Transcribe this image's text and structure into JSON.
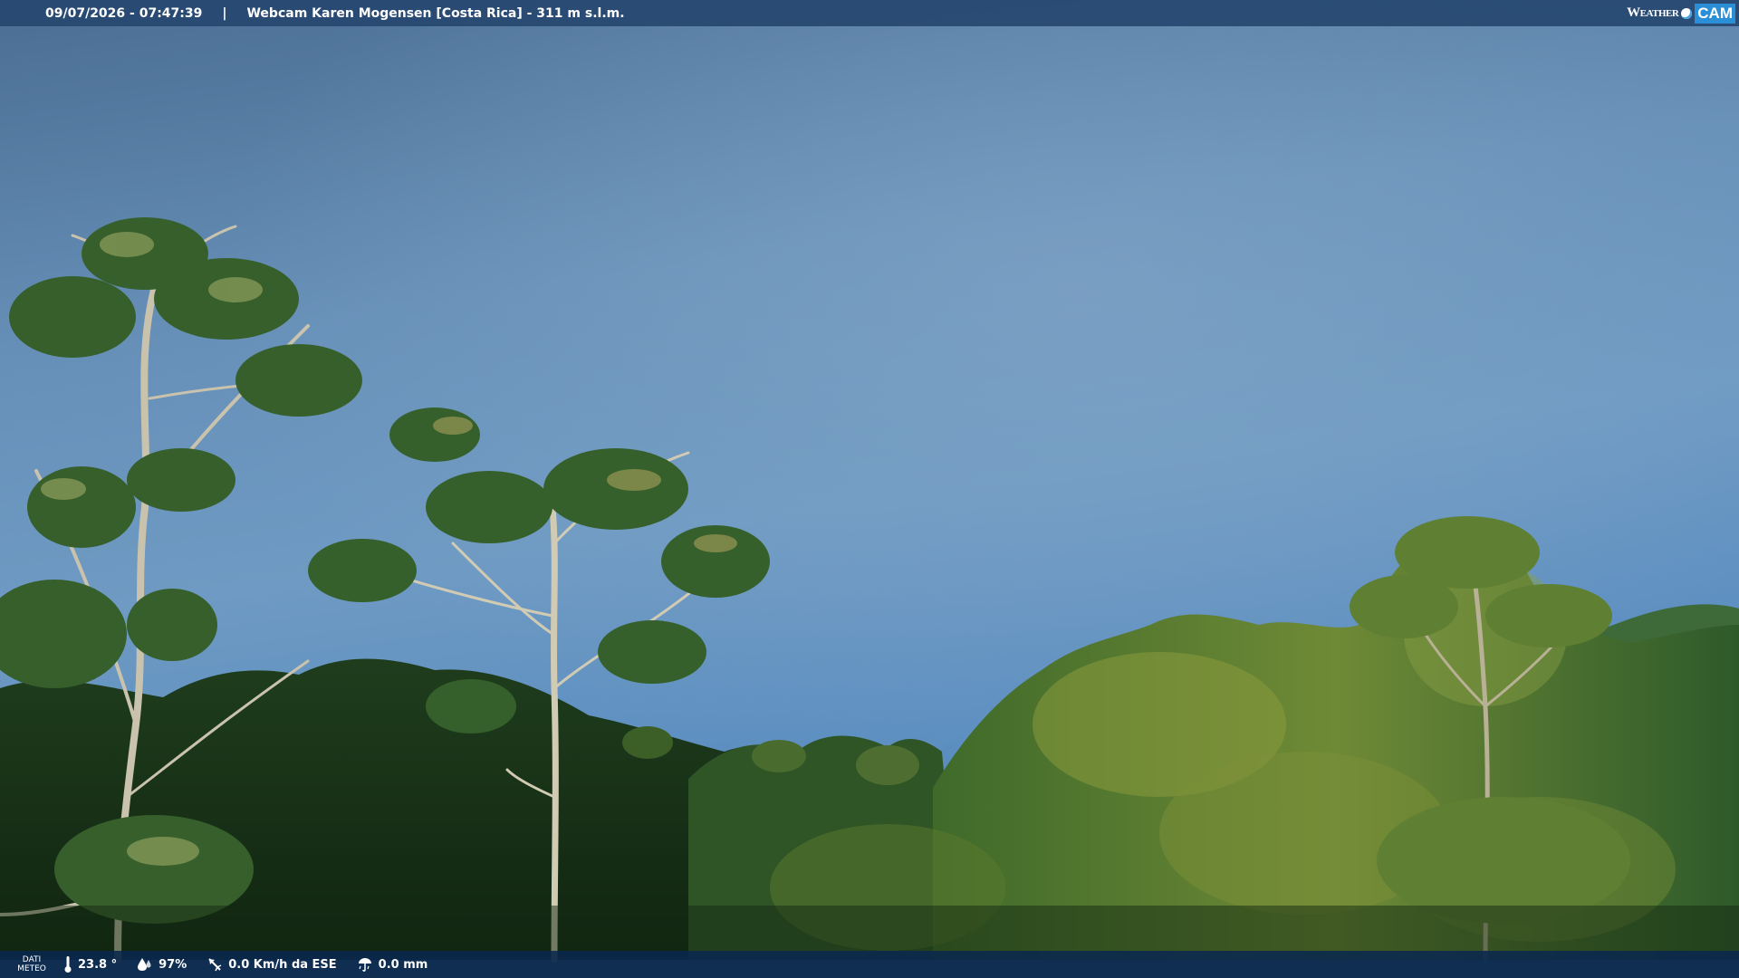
{
  "header": {
    "datetime": "09/07/2026 - 07:47:39",
    "separator": "|",
    "title": "Webcam Karen Mogensen [Costa Rica]  - 311 m s.l.m."
  },
  "logo": {
    "text_left": "Weather",
    "text_right": "CAM"
  },
  "weather": {
    "section_label_1": "DATI",
    "section_label_2": "METEO",
    "temperature": "23.8 °",
    "humidity": "97%",
    "wind": "0.0 Km/h da ESE",
    "rain": "0.0 mm"
  },
  "icons": {
    "temperature": "thermometer-icon",
    "humidity": "humidity-drop-icon",
    "wind": "wind-vane-icon",
    "rain": "rain-gauge-icon"
  },
  "colors": {
    "sky_top": "#4c7197",
    "sky_mid": "#6b95bd",
    "sky_low": "#5f93c6",
    "foliage_dark": "#23401f",
    "foliage_light": "#8a9a3d",
    "bar_top": "#264870",
    "bar_bottom": "#0a284e"
  }
}
